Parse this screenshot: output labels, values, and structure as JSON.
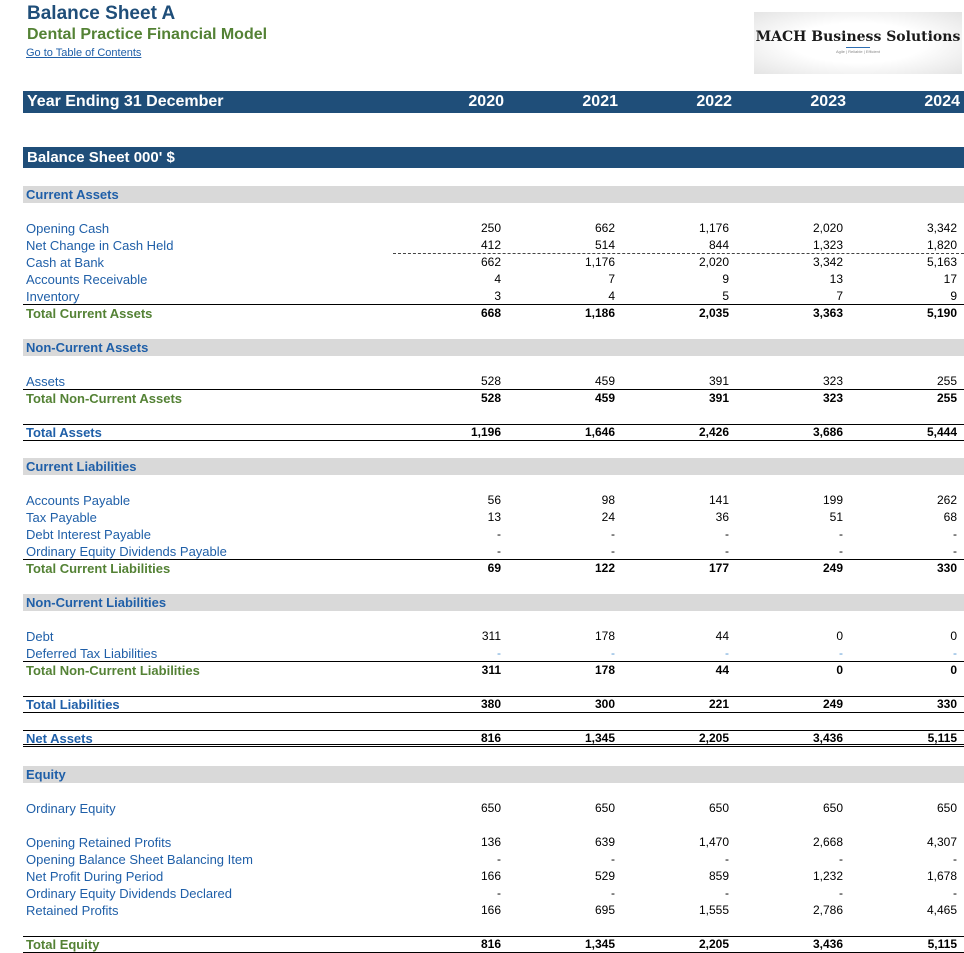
{
  "header": {
    "title": "Balance Sheet A",
    "subtitle": "Dental Practice Financial Model",
    "toc_link": "Go to Table of Contents",
    "logo_name": "MACH Business Solutions",
    "logo_tagline": "Agile | Reliable | Efficient"
  },
  "year_bar": {
    "label": "Year Ending 31 December",
    "years": [
      "2020",
      "2021",
      "2022",
      "2023",
      "2024"
    ]
  },
  "sheet_bar": {
    "label": "Balance Sheet 000' $"
  },
  "sections": {
    "current_assets": "Current Assets",
    "non_current_assets": "Non-Current Assets",
    "current_liabilities": "Current Liabilities",
    "non_current_liabilities": "Non-Current Liabilities",
    "equity": "Equity"
  },
  "rows": {
    "opening_cash": {
      "label": "Opening Cash",
      "values": [
        "250",
        "662",
        "1,176",
        "2,020",
        "3,342"
      ]
    },
    "net_change_cash": {
      "label": "Net Change in Cash Held",
      "values": [
        "412",
        "514",
        "844",
        "1,323",
        "1,820"
      ]
    },
    "cash_at_bank": {
      "label": "Cash at Bank",
      "values": [
        "662",
        "1,176",
        "2,020",
        "3,342",
        "5,163"
      ]
    },
    "accounts_receivable": {
      "label": "Accounts Receivable",
      "values": [
        "4",
        "7",
        "9",
        "13",
        "17"
      ]
    },
    "inventory": {
      "label": "Inventory",
      "values": [
        "3",
        "4",
        "5",
        "7",
        "9"
      ]
    },
    "total_current_assets": {
      "label": "Total Current Assets",
      "values": [
        "668",
        "1,186",
        "2,035",
        "3,363",
        "5,190"
      ]
    },
    "assets": {
      "label": "Assets",
      "values": [
        "528",
        "459",
        "391",
        "323",
        "255"
      ]
    },
    "total_non_current_assets": {
      "label": "Total Non-Current Assets",
      "values": [
        "528",
        "459",
        "391",
        "323",
        "255"
      ]
    },
    "total_assets": {
      "label": "Total Assets",
      "values": [
        "1,196",
        "1,646",
        "2,426",
        "3,686",
        "5,444"
      ]
    },
    "accounts_payable": {
      "label": "Accounts Payable",
      "values": [
        "56",
        "98",
        "141",
        "199",
        "262"
      ]
    },
    "tax_payable": {
      "label": "Tax Payable",
      "values": [
        "13",
        "24",
        "36",
        "51",
        "68"
      ]
    },
    "debt_interest_payable": {
      "label": "Debt Interest Payable",
      "values": [
        "-",
        "-",
        "-",
        "-",
        "-"
      ]
    },
    "dividends_payable": {
      "label": "Ordinary Equity Dividends Payable",
      "values": [
        "-",
        "-",
        "-",
        "-",
        "-"
      ]
    },
    "total_current_liabilities": {
      "label": "Total Current Liabilities",
      "values": [
        "69",
        "122",
        "177",
        "249",
        "330"
      ]
    },
    "debt": {
      "label": "Debt",
      "values": [
        "311",
        "178",
        "44",
        "0",
        "0"
      ]
    },
    "deferred_tax": {
      "label": "Deferred Tax Liabilities",
      "values": [
        "-",
        "-",
        "-",
        "-",
        "-"
      ]
    },
    "total_non_current_liabilities": {
      "label": "Total Non-Current Liabilities",
      "values": [
        "311",
        "178",
        "44",
        "0",
        "0"
      ]
    },
    "total_liabilities": {
      "label": "Total Liabilities",
      "values": [
        "380",
        "300",
        "221",
        "249",
        "330"
      ]
    },
    "net_assets": {
      "label": "Net Assets",
      "values": [
        "816",
        "1,345",
        "2,205",
        "3,436",
        "5,115"
      ]
    },
    "ordinary_equity": {
      "label": "Ordinary Equity",
      "values": [
        "650",
        "650",
        "650",
        "650",
        "650"
      ]
    },
    "opening_retained_profits": {
      "label": "Opening Retained Profits",
      "values": [
        "136",
        "639",
        "1,470",
        "2,668",
        "4,307"
      ]
    },
    "balancing_item": {
      "label": "Opening Balance Sheet Balancing Item",
      "values": [
        "-",
        "-",
        "-",
        "-",
        "-"
      ]
    },
    "net_profit": {
      "label": "Net Profit During Period",
      "values": [
        "166",
        "529",
        "859",
        "1,232",
        "1,678"
      ]
    },
    "dividends_declared": {
      "label": "Ordinary Equity Dividends Declared",
      "values": [
        "-",
        "-",
        "-",
        "-",
        "-"
      ]
    },
    "retained_profits": {
      "label": "Retained Profits",
      "values": [
        "166",
        "695",
        "1,555",
        "2,786",
        "4,465"
      ]
    },
    "total_equity": {
      "label": "Total Equity",
      "values": [
        "816",
        "1,345",
        "2,205",
        "3,436",
        "5,115"
      ]
    }
  }
}
